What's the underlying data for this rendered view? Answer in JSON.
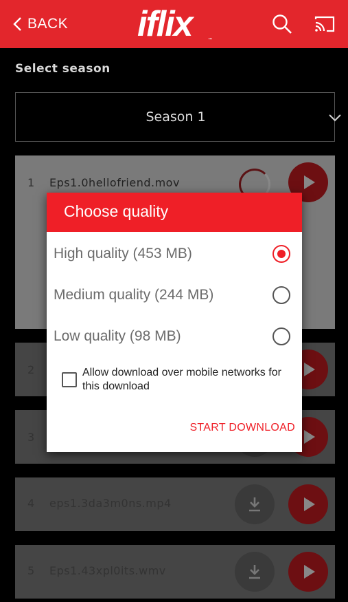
{
  "header": {
    "back_label": "BACK",
    "logo_text": "iflix",
    "logo_tm": "™"
  },
  "season": {
    "section_label": "Select season",
    "selected": "Season 1"
  },
  "episodes": [
    {
      "num": "1",
      "title": "Eps1.0hellofriend.mov",
      "state": "downloading"
    },
    {
      "num": "2",
      "title": "",
      "state": "download"
    },
    {
      "num": "3",
      "title": "",
      "state": "download"
    },
    {
      "num": "4",
      "title": "eps1.3da3m0ns.mp4",
      "state": "download"
    },
    {
      "num": "5",
      "title": "Eps1.43xpl0its.wmv",
      "state": "download"
    }
  ],
  "dialog": {
    "title": "Choose quality",
    "options": [
      {
        "label": "High quality (453 MB)",
        "selected": true
      },
      {
        "label": "Medium quality (244 MB)",
        "selected": false
      },
      {
        "label": "Low quality (98 MB)",
        "selected": false
      }
    ],
    "checkbox_label": "Allow download over mobile networks for this download",
    "checkbox_checked": false,
    "start_label": "START DOWNLOAD"
  },
  "colors": {
    "brand_red": "#e3262c",
    "dialog_red": "#ef1f27",
    "background": "#000000"
  },
  "icons": [
    "chevron-left-icon",
    "search-icon",
    "cast-icon",
    "chevron-down-icon",
    "download-icon",
    "play-icon"
  ]
}
